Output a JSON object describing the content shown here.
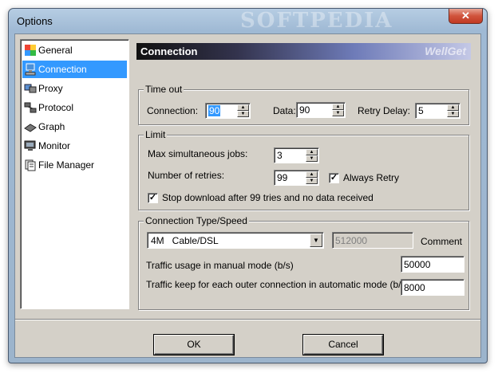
{
  "window": {
    "title": "Options",
    "watermark": "SOFTPEDIA",
    "close_glyph": "✕"
  },
  "nav": {
    "items": [
      {
        "label": "General",
        "icon": "general-icon"
      },
      {
        "label": "Connection",
        "icon": "connection-icon",
        "selected": true
      },
      {
        "label": "Proxy",
        "icon": "proxy-icon"
      },
      {
        "label": "Protocol",
        "icon": "protocol-icon"
      },
      {
        "label": "Graph",
        "icon": "graph-icon"
      },
      {
        "label": "Monitor",
        "icon": "monitor-icon"
      },
      {
        "label": "File Manager",
        "icon": "file-manager-icon"
      }
    ]
  },
  "header": {
    "title": "Connection",
    "brand": "WellGet"
  },
  "timeout": {
    "group_label": "Time out",
    "connection_label": "Connection:",
    "connection_value": "90",
    "data_label": "Data:",
    "data_value": "90",
    "retry_label": "Retry Delay:",
    "retry_value": "5"
  },
  "limit": {
    "group_label": "Limit",
    "max_jobs_label": "Max simultaneous jobs:",
    "max_jobs_value": "3",
    "retries_label": "Number of retries:",
    "retries_value": "99",
    "always_retry_label": "Always Retry",
    "always_retry_checked": true,
    "stop_label": "Stop download after 99 tries and no data received",
    "stop_checked": true
  },
  "conn_type": {
    "group_label": "Connection Type/Speed",
    "selected": "4M   Cable/DSL",
    "speed_value": "512000",
    "comment_label": "Comment",
    "manual_label": "Traffic usage in manual mode (b/s)",
    "manual_value": "50000",
    "auto_label": "Traffic keep for each outer connection in automatic mode (b/s)",
    "auto_value": "8000"
  },
  "buttons": {
    "ok": "OK",
    "cancel": "Cancel"
  },
  "colors": {
    "selection": "#3399ff",
    "dialog_bg": "#d4d0c8",
    "close_red": "#c13a23"
  }
}
